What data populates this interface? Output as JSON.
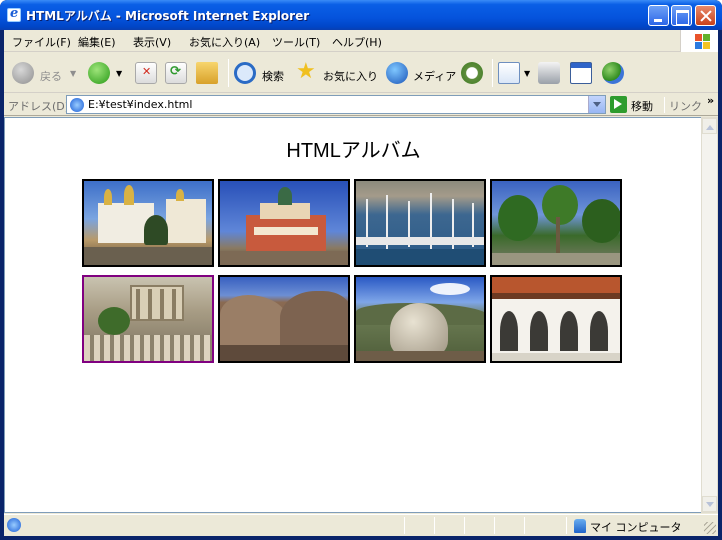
{
  "window": {
    "title": "HTMLアルバム - Microsoft Internet Explorer",
    "buttons": {
      "minimize": "minimize-button",
      "maximize": "maximize-button",
      "close": "close-button"
    }
  },
  "menubar": {
    "items": [
      "ファイル(F)",
      "編集(E)",
      "表示(V)",
      "お気に入り(A)",
      "ツール(T)",
      "ヘルプ(H)"
    ]
  },
  "toolbar": {
    "back": "戻る",
    "search": "検索",
    "favorites": "お気に入り",
    "media": "メディア"
  },
  "address": {
    "label": "アドレス(D)",
    "value": "E:¥test¥index.html",
    "go": "移動",
    "links": "リンク",
    "more": "»"
  },
  "content": {
    "title": "HTMLアルバム",
    "thumbnails": [
      {
        "name": "thumb-kremlin-cathedrals",
        "visited": false
      },
      {
        "name": "thumb-red-church",
        "visited": false
      },
      {
        "name": "thumb-harbor-boats",
        "visited": false
      },
      {
        "name": "thumb-palm-garden",
        "visited": false
      },
      {
        "name": "thumb-ancient-ruins",
        "visited": true
      },
      {
        "name": "thumb-rocky-valley",
        "visited": false
      },
      {
        "name": "thumb-boulder-mountain",
        "visited": false
      },
      {
        "name": "thumb-white-arcade",
        "visited": false
      }
    ]
  },
  "status": {
    "text": "",
    "zone": "マイ コンピュータ"
  },
  "colors": {
    "titlebar": "#0553dc",
    "chrome": "#ece9d8",
    "thumb_border": "#000000",
    "thumb_visited_border": "#800080"
  }
}
